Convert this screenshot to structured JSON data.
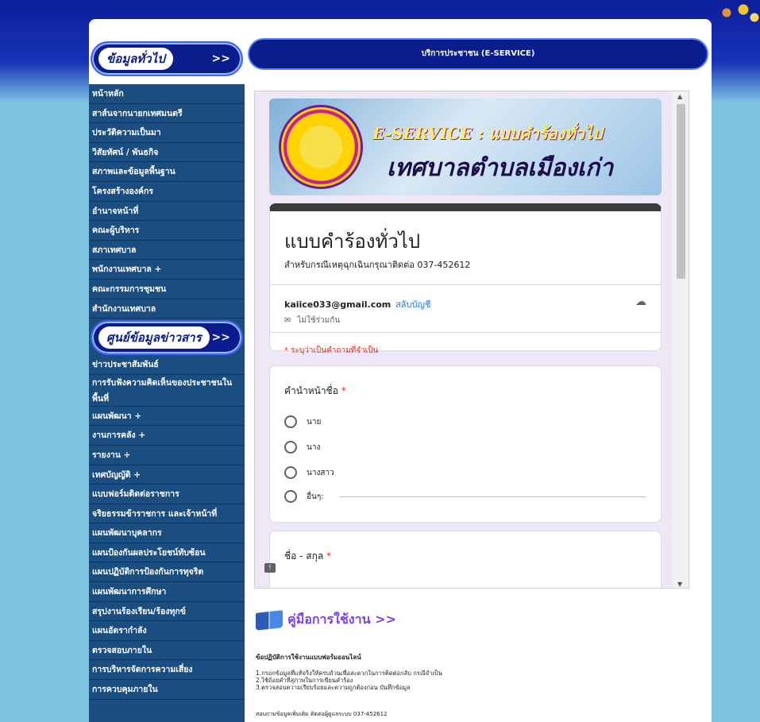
{
  "sidebar": {
    "section1_title": "ข้อมูลทั่วไป",
    "section1_arrow": ">>",
    "section1_items": [
      "หน้าหลัก",
      "สาส์นจากนายกเทศมนตรี",
      "ประวัติความเป็นมา",
      "วิสัยทัศน์ / พันธกิจ",
      "สภาพและข้อมูลพื้นฐาน",
      "โครงสร้างองค์กร",
      "อำนาจหน้าที่",
      "คณะผู้บริหาร",
      "สภาเทศบาล",
      "พนักงานเทศบาล +",
      "คณะกรรมการชุมชน",
      "สำนักงานเทศบาล"
    ],
    "section2_title": "ศูนย์ข้อมูลข่าวสาร",
    "section2_arrow": ">>",
    "section2_items": [
      "ข่าวประชาสัมพันธ์",
      "การรับฟังความคิดเห็นของประชาชนในพื้นที่",
      "แผนพัฒนา +",
      "งานการคลัง +",
      "รายงาน +",
      "เทศบัญญัติ +",
      "แบบฟอร์มติดต่อราชการ",
      "จริยธรรมข้าราชการ และเจ้าหน้าที่",
      "แผนพัฒนาบุคลากร",
      "แผนป้องกันผลประโยชน์ทับซ้อน",
      "แผนปฏิบัติการป้องกันการทุจริต",
      "แผนพัฒนาการศึกษา",
      "สรุปงานร้องเรียน/ร้องทุกข์",
      "แผนอัตรากำลัง",
      "ตรวจสอบภายใน",
      "การบริหารจัดการความเสี่ยง",
      "การควบคุมภายใน"
    ]
  },
  "banner": {
    "title": "บริการประชาชน (E-SERVICE)"
  },
  "hero": {
    "english": "E-SERVICE : แบบคำร้องทั่วไป",
    "thai": "เทศบาลตำบลเมืองเก่า"
  },
  "form": {
    "title": "แบบคำร้องทั่วไป",
    "description": "สำหรับกรณีเหตุฉุกเฉินกรุณาติดต่อ 037-452612",
    "email": "kaiice033@gmail.com",
    "switch_account": "สลับบัญชี",
    "not_shared": "ไม่ใช้ร่วมกัน",
    "required_note": "* ระบุว่าเป็นคำถามที่จำเป็น",
    "q1_label": "คำนำหน้าชื่อ",
    "q1_options": [
      "นาย",
      "นาง",
      "นางสาว",
      "อื่นๆ:"
    ],
    "q2_label": "ชื่อ - สกุล",
    "required_star": "*"
  },
  "manual": {
    "link": "คู่มือการใช้งาน >>",
    "rules_title": "ข้อปฏิบัติการใช้งานแบบฟอร์มออนไลน์",
    "rules": [
      "1.กรอกข้อมูลที่แท้จริงให้ครบถ้วนเพื่อสะดวกในการติดต่อกลับ กรณีจำเป็น",
      "2.ใช้ถ้อยคำที่สุภาพในการเขียนคำร้อง",
      "3.ตรวจสอบความเรียบร้อยและความถูกต้องก่อน บันทึกข้อมูล"
    ],
    "contact": "สอบถามข้อมูลเพิ่มเติม ติดต่อผู้ดูแลระบบ 037-452612"
  },
  "icons": {
    "cloud": "cloud-check-icon",
    "share": "mail-icon",
    "feedback": "feedback-icon",
    "book": "book-icon"
  },
  "colors": {
    "sidebar_bg": "#1b4e80",
    "banner_bg": "#0a1d8c",
    "required": "#d93025",
    "link": "#1a73e8",
    "manual_link": "#7b3fe4"
  }
}
